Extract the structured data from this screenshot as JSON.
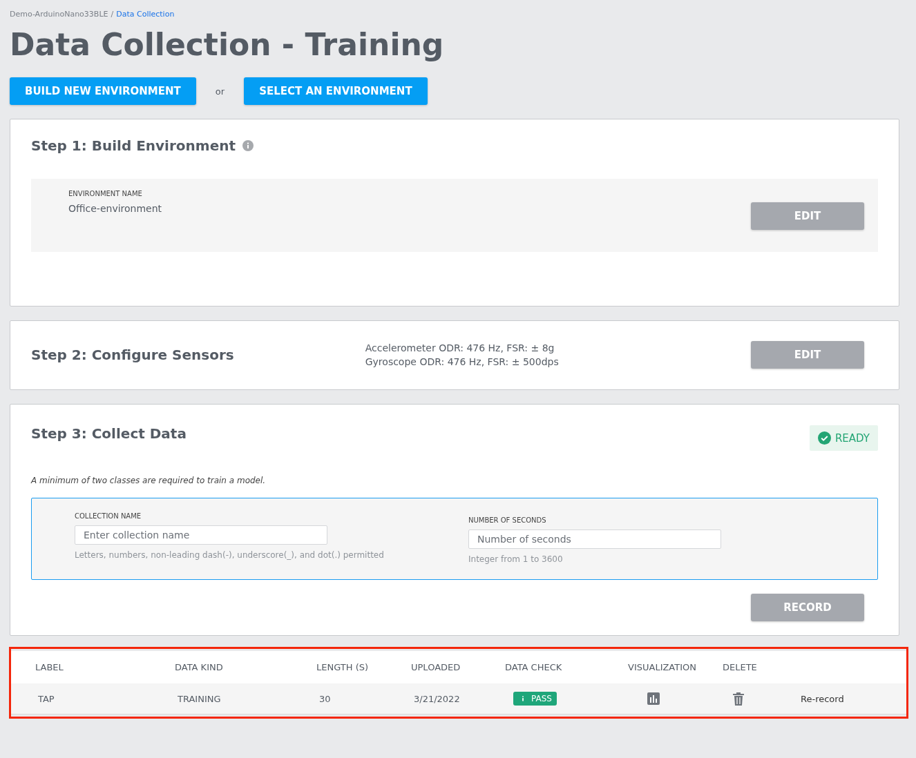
{
  "breadcrumb": {
    "project": "Demo-ArduinoNano33BLE",
    "separator": "/",
    "current": "Data Collection"
  },
  "title": "Data Collection - Training",
  "actions": {
    "build": "BUILD NEW ENVIRONMENT",
    "or": "or",
    "select": "SELECT AN ENVIRONMENT"
  },
  "step1": {
    "title": "Step 1: Build Environment",
    "field_label": "ENVIRONMENT NAME",
    "field_value": "Office-environment",
    "button": {
      "label": "EDIT",
      "disabled": true
    }
  },
  "step2": {
    "title": "Step 2: Configure Sensors",
    "lines": [
      "Accelerometer ODR: 476 Hz, FSR: ± 8g",
      "Gyroscope ODR: 476 Hz, FSR: ± 500dps"
    ],
    "button": {
      "label": "EDIT",
      "disabled": true
    }
  },
  "step3": {
    "title": "Step 3: Collect Data",
    "status": "READY",
    "note": "A minimum of two classes are required to train a model.",
    "fields": [
      {
        "label": "COLLECTION NAME",
        "placeholder": "Enter collection name",
        "hint": "Letters, numbers, non-leading dash(-), underscore(_), and dot(.) permitted"
      },
      {
        "label": "NUMBER OF SECONDS",
        "placeholder": "Number of seconds",
        "hint": "Integer from 1 to 3600"
      }
    ],
    "button": {
      "label": "RECORD",
      "disabled": true
    }
  },
  "table": {
    "columns": [
      "LABEL",
      "DATA KIND",
      "LENGTH (S)",
      "UPLOADED",
      "DATA CHECK",
      "VISUALIZATION",
      "DELETE"
    ],
    "rows": [
      {
        "label": "TAP",
        "data_kind": "TRAINING",
        "length": "30",
        "uploaded": "3/21/2022",
        "data_check": "PASS",
        "action": "Re-record"
      }
    ]
  }
}
